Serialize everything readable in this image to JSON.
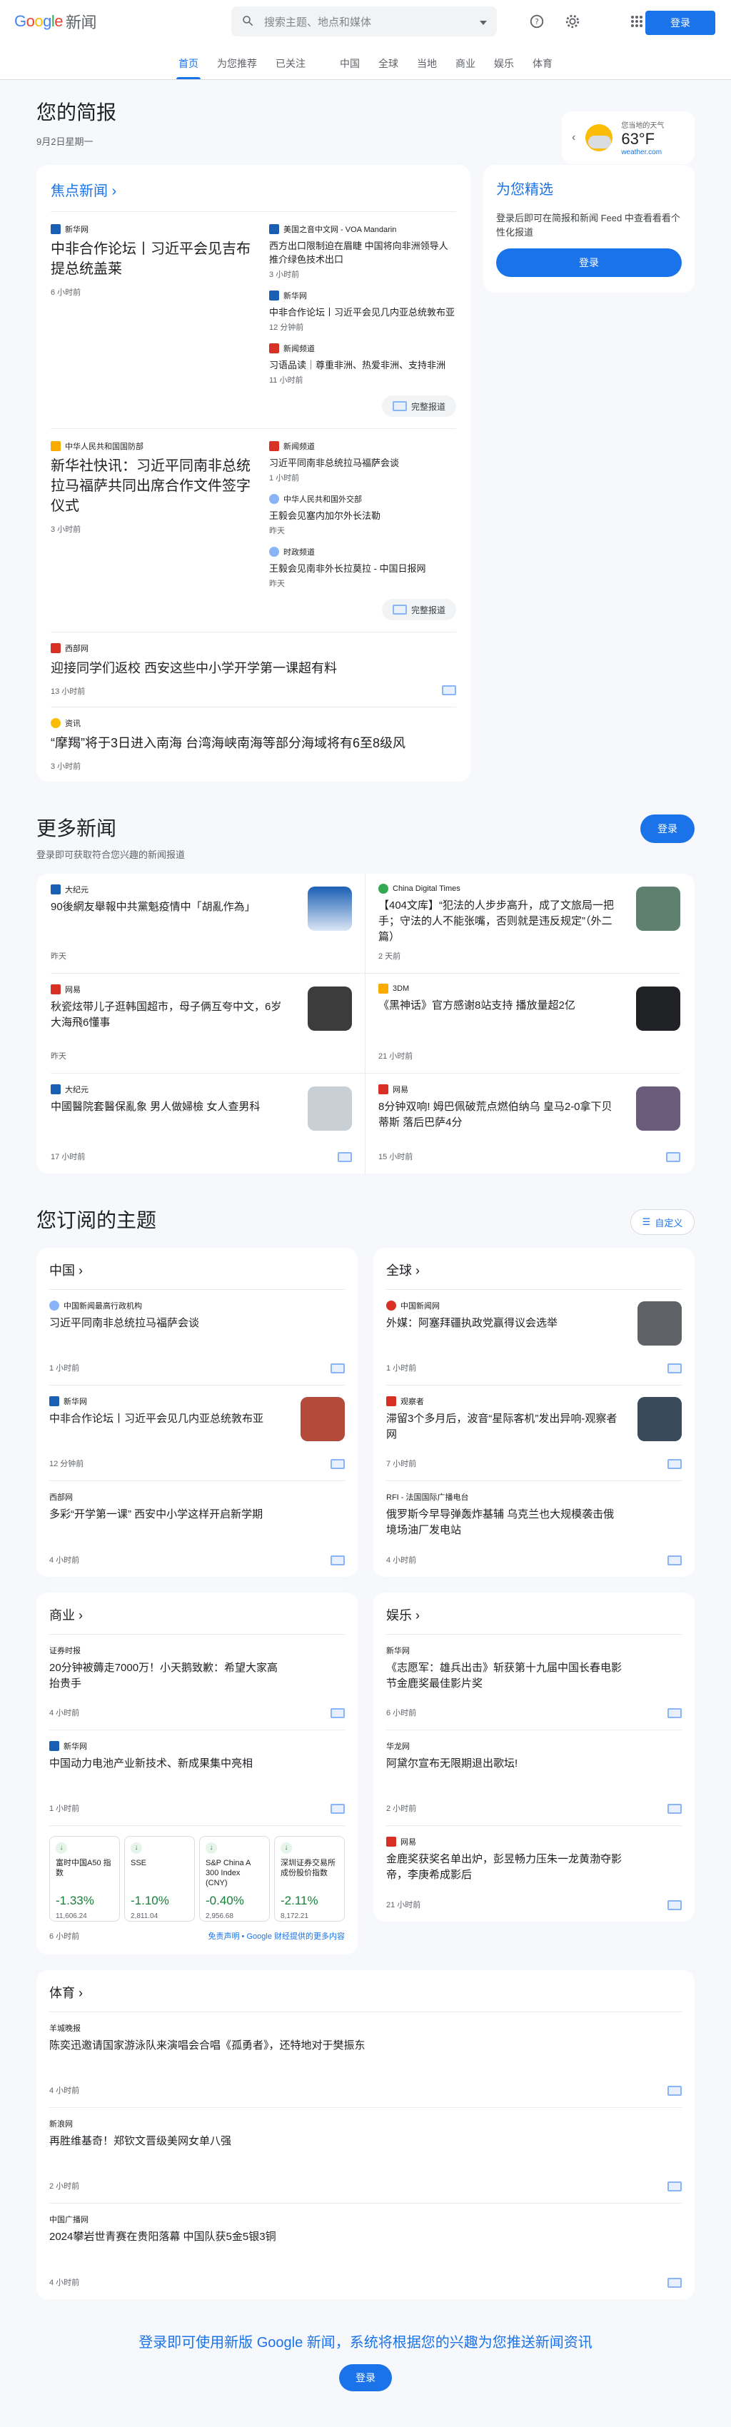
{
  "header": {
    "logo_text": "新闻",
    "search_placeholder": "搜索主题、地点和媒体",
    "signin": "登录"
  },
  "nav": {
    "tabs": [
      "首页",
      "为您推荐",
      "已关注",
      "中国",
      "全球",
      "当地",
      "商业",
      "娱乐",
      "体育"
    ]
  },
  "briefing": {
    "title": "您的简报",
    "date": "9月2日星期一"
  },
  "weather": {
    "location": "您当地的天气",
    "temp": "63°F",
    "source": "weather.com"
  },
  "focus": {
    "title": "焦点新闻",
    "cluster1": {
      "main": {
        "source": "新华网",
        "headline": "中非合作论坛丨习近平会见吉布提总统盖莱",
        "time": "6 小时前"
      },
      "items": [
        {
          "source": "美国之音中文网 - VOA Mandarin",
          "headline": "西方出口限制迫在眉睫 中国将向非洲领导人推介绿色技术出口",
          "time": "3 小时前"
        },
        {
          "source": "新华网",
          "headline": "中非合作论坛丨习近平会见几内亚总统敦布亚",
          "time": "12 分钟前"
        },
        {
          "source": "新闻频道",
          "headline": "习语品读｜尊重非洲、热爱非洲、支持非洲",
          "time": "11 小时前"
        }
      ],
      "full": "完整报道"
    },
    "cluster2": {
      "main": {
        "source": "中华人民共和国国防部",
        "headline": "新华社快讯：习近平同南非总统拉马福萨共同出席合作文件签字仪式",
        "time": "3 小时前"
      },
      "items": [
        {
          "source": "新闻频道",
          "headline": "习近平同南非总统拉马福萨会谈",
          "time": "1 小时前"
        },
        {
          "source": "中华人民共和国外交部",
          "headline": "王毅会见塞内加尔外长法勒",
          "time": "昨天"
        },
        {
          "source": "时政频道",
          "headline": "王毅会见南非外长拉莫拉 - 中国日报网",
          "time": "昨天"
        }
      ],
      "full": "完整报道"
    },
    "stories": [
      {
        "source": "西部网",
        "headline": "迎接同学们返校 西安这些中小学开学第一课超有料",
        "time": "13 小时前"
      },
      {
        "source": "资讯",
        "headline": "“摩羯”将于3日进入南海 台湾海峡南海等部分海域将有6至8级风",
        "time": "3 小时前"
      }
    ]
  },
  "picks": {
    "title": "为您精选",
    "desc": "登录后即可在简报和新闻 Feed 中查看看看个性化报道",
    "btn": "登录"
  },
  "more": {
    "title": "更多新闻",
    "sub": "登录即可获取符合您兴趣的新闻报道",
    "btn": "登录",
    "items": [
      {
        "source": "大纪元",
        "headline": "90後網友舉報中共黨魁疫情中「胡亂作為」",
        "time": "昨天"
      },
      {
        "source": "China Digital Times",
        "headline": "【404文库】“犯法的人步步高升，成了文旅局一把手；守法的人不能张嘴，否则就是违反规定”（外二篇）",
        "time": "2 天前"
      },
      {
        "source": "网易",
        "headline": "秋瓷炫带儿子逛韩国超市，母子俩互夸中文，6岁大海飛6懂事",
        "time": "昨天"
      },
      {
        "source": "3DM",
        "headline": "《黑神话》官方感谢8站支持 播放量超2亿",
        "time": "21 小时前"
      },
      {
        "source": "大纪元",
        "headline": "中國醫院套醫保亂象 男人做婦檢 女人查男科",
        "time": "17 小时前"
      },
      {
        "source": "网易",
        "headline": "8分钟双响! 姆巴佩破荒点燃伯纳乌 皇马2-0拿下贝蒂斯 落后巴萨4分",
        "time": "15 小时前"
      }
    ]
  },
  "topics": {
    "title": "您订阅的主题",
    "customize": "自定义",
    "china": {
      "title": "中国",
      "items": [
        {
          "source": "中国新闻最高行政机构",
          "headline": "习近平同南非总统拉马福萨会谈",
          "time": "1 小时前"
        },
        {
          "source": "新华网",
          "headline": "中非合作论坛丨习近平会见几内亚总统敦布亚",
          "time": "12 分钟前"
        },
        {
          "source": "西部网",
          "headline": "多彩“开学第一课” 西安中小学这样开启新学期",
          "time": "4 小时前"
        }
      ]
    },
    "world": {
      "title": "全球",
      "items": [
        {
          "source": "中国新闻网",
          "headline": "外媒：阿塞拜疆执政党赢得议会选举",
          "time": "1 小时前"
        },
        {
          "source": "观察者",
          "headline": "滞留3个多月后，波音“星际客机”发出异响-观察者网",
          "time": "7 小时前"
        },
        {
          "source": "RFI - 法国国际广播电台",
          "headline": "俄罗斯今早导弹轰炸基辅 乌克兰也大规模袭击俄境场油厂发电站",
          "time": "4 小时前"
        }
      ]
    },
    "business": {
      "title": "商业",
      "items": [
        {
          "source": "证券时报",
          "headline": "20分钟被薅走7000万！小天鹅致歉：希望大家高抬贵手",
          "time": "4 小时前"
        },
        {
          "source": "新华网",
          "headline": "中国动力电池产业新技术、新成果集中亮相",
          "time": "1 小时前"
        }
      ],
      "stocks": [
        {
          "name": "富时中国A50 指数",
          "pct": "-1.33%",
          "val": "11,606.24"
        },
        {
          "name": "SSE",
          "pct": "-1.10%",
          "val": "2,811.04"
        },
        {
          "name": "S&P China A 300 Index (CNY)",
          "pct": "-0.40%",
          "val": "2,956.68"
        },
        {
          "name": "深圳证券交易所成份股价指数",
          "pct": "-2.11%",
          "val": "8,172.21"
        }
      ],
      "time": "6 小时前",
      "disclaimer": "免责声明 • Google 财经提供的更多内容"
    },
    "ent": {
      "title": "娱乐",
      "items": [
        {
          "source": "新华网",
          "headline": "《志愿军：雄兵出击》斩获第十九届中国长春电影节金鹿奖最佳影片奖",
          "time": "6 小时前"
        },
        {
          "source": "华龙网",
          "headline": "阿黛尔宣布无限期退出歌坛!",
          "time": "2 小时前"
        },
        {
          "source": "网易",
          "headline": "金鹿奖获奖名单出炉，彭昱畅力压朱一龙黄渤夺影帝，李庚希成影后",
          "time": "21 小时前"
        }
      ]
    },
    "sports": {
      "title": "体育",
      "items": [
        {
          "source": "羊城晚报",
          "headline": "陈奕迅邀请国家游泳队来演唱会合唱《孤勇者》，还特地对于樊振东",
          "time": "4 小时前"
        },
        {
          "source": "新浪网",
          "headline": "再胜维基奇！郑钦文晋级美网女单八强",
          "time": "2 小时前"
        },
        {
          "source": "中国广播网",
          "headline": "2024攀岩世青赛在贵阳落幕 中国队获5金5银3铜",
          "time": "4 小时前"
        }
      ]
    }
  },
  "footer": {
    "text": "登录即可使用新版 Google 新闻，系统将根据您的兴趣为您推送新闻资讯",
    "btn": "登录"
  }
}
